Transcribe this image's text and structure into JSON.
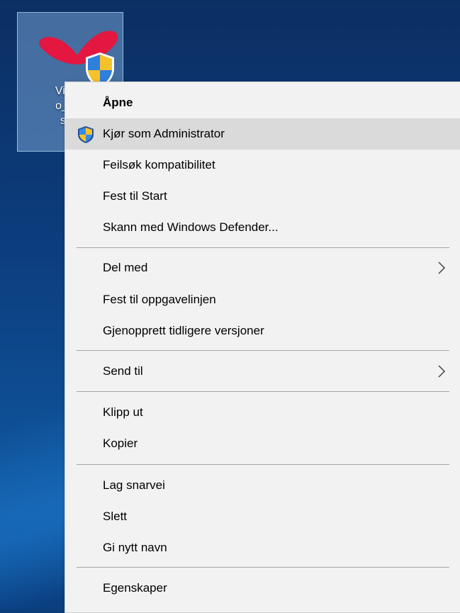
{
  "desktop_icon": {
    "label_lines": [
      "Visma",
      "o_Tim",
      "setu"
    ]
  },
  "context_menu": {
    "items": [
      {
        "label": "Åpne"
      },
      {
        "label": "Kjør som Administrator"
      },
      {
        "label": "Feilsøk kompatibilitet"
      },
      {
        "label": "Fest til Start"
      },
      {
        "label": "Skann med Windows Defender..."
      },
      {
        "label": "Del med"
      },
      {
        "label": "Fest til oppgavelinjen"
      },
      {
        "label": "Gjenopprett tidligere versjoner"
      },
      {
        "label": "Send til"
      },
      {
        "label": "Klipp ut"
      },
      {
        "label": "Kopier"
      },
      {
        "label": "Lag snarvei"
      },
      {
        "label": "Slett"
      },
      {
        "label": "Gi nytt navn"
      },
      {
        "label": "Egenskaper"
      }
    ]
  },
  "colors": {
    "menu_background": "#f2f2f2",
    "hover_background": "#dadada",
    "separator": "#a6a6a6",
    "brand_red": "#e3173f"
  }
}
